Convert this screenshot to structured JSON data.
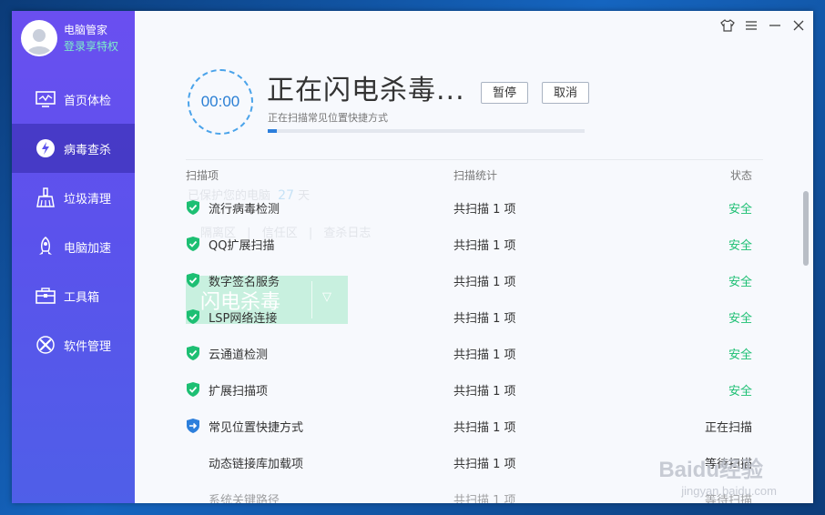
{
  "profile": {
    "name": "电脑管家",
    "login_link": "登录享特权"
  },
  "sidebar": {
    "items": [
      {
        "label": "首页体检",
        "icon": "monitor-icon",
        "active": false
      },
      {
        "label": "病毒查杀",
        "icon": "lightning-shield-icon",
        "active": true
      },
      {
        "label": "垃圾清理",
        "icon": "broom-icon",
        "active": false
      },
      {
        "label": "电脑加速",
        "icon": "rocket-icon",
        "active": false
      },
      {
        "label": "工具箱",
        "icon": "toolbox-icon",
        "active": false
      },
      {
        "label": "软件管理",
        "icon": "apps-icon",
        "active": false
      }
    ]
  },
  "window_controls": [
    "skin-icon",
    "menu-icon",
    "minimize-icon",
    "close-icon"
  ],
  "scan": {
    "timer": "00:00",
    "title": "正在闪电杀毒...",
    "pause_label": "暂停",
    "cancel_label": "取消",
    "subtitle": "正在扫描常见位置快捷方式",
    "progress_percent": 3
  },
  "background_ghost": {
    "protect_prefix": "已保护您的电脑",
    "protect_days": "27",
    "protect_unit": "天",
    "links": [
      "隔离区",
      "信任区",
      "查杀日志"
    ],
    "button_label": "闪电杀毒"
  },
  "table": {
    "headers": [
      "扫描项",
      "扫描统计",
      "状态"
    ],
    "rows": [
      {
        "name": "流行病毒检测",
        "stat": "共扫描 1 项",
        "status": "安全",
        "state": "safe"
      },
      {
        "name": "QQ扩展扫描",
        "stat": "共扫描 1 项",
        "status": "安全",
        "state": "safe"
      },
      {
        "name": "数字签名服务",
        "stat": "共扫描 1 项",
        "status": "安全",
        "state": "safe"
      },
      {
        "name": "LSP网络连接",
        "stat": "共扫描 1 项",
        "status": "安全",
        "state": "safe"
      },
      {
        "name": "云通道检测",
        "stat": "共扫描 1 项",
        "status": "安全",
        "state": "safe"
      },
      {
        "name": "扩展扫描项",
        "stat": "共扫描 1 项",
        "status": "安全",
        "state": "safe"
      },
      {
        "name": "常见位置快捷方式",
        "stat": "共扫描 1 项",
        "status": "正在扫描",
        "state": "scanning"
      },
      {
        "name": "动态链接库加载项",
        "stat": "共扫描 1 项",
        "status": "等待扫描",
        "state": "waiting"
      },
      {
        "name": "系统关键路径",
        "stat": "共扫描 1 项",
        "status": "等待扫描",
        "state": "waiting"
      }
    ]
  },
  "watermark": {
    "line1": "Baidu经验",
    "line2": "jingyan.baidu.com"
  },
  "colors": {
    "sidebar": "#5b52ec",
    "safe": "#1dbf73",
    "accent": "#2c7fdc"
  }
}
